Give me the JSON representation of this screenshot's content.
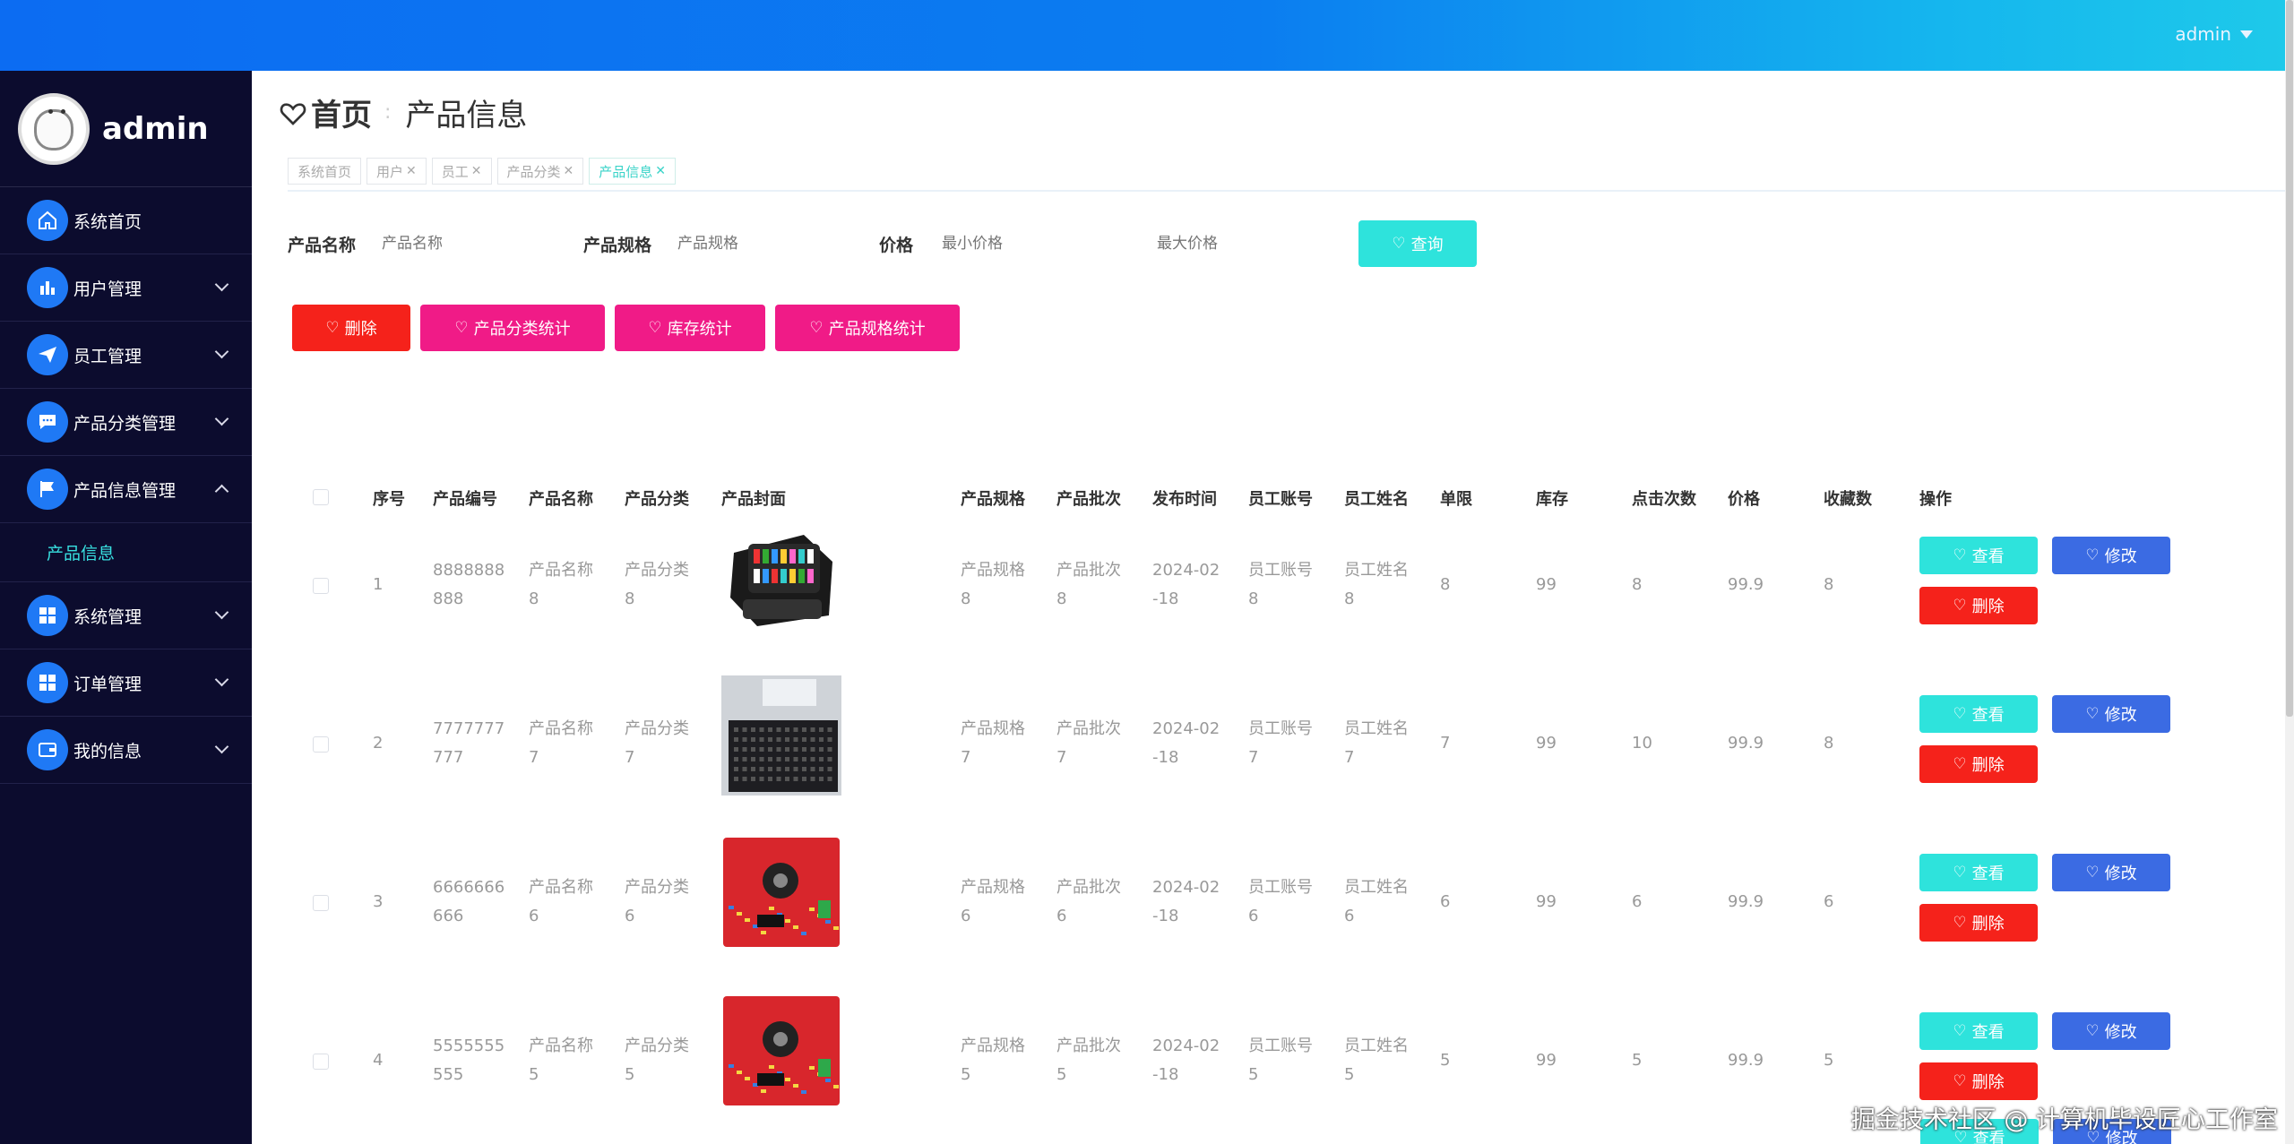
{
  "header": {
    "user": "admin"
  },
  "sidebar": {
    "profile_name": "admin",
    "items": [
      {
        "label": "系统首页",
        "icon": "home-icon"
      },
      {
        "label": "用户管理",
        "icon": "bar-chart-icon"
      },
      {
        "label": "员工管理",
        "icon": "send-icon"
      },
      {
        "label": "产品分类管理",
        "icon": "chat-icon"
      },
      {
        "label": "产品信息管理",
        "icon": "flag-icon"
      },
      {
        "label": "系统管理",
        "icon": "grid-icon"
      },
      {
        "label": "订单管理",
        "icon": "grid-icon"
      },
      {
        "label": "我的信息",
        "icon": "wallet-icon"
      }
    ],
    "submenu": {
      "label": "产品信息"
    }
  },
  "breadcrumb": {
    "home": "首页",
    "sep": ":",
    "current": "产品信息"
  },
  "tabs": [
    {
      "label": "系统首页",
      "closable": false
    },
    {
      "label": "用户",
      "closable": true
    },
    {
      "label": "员工",
      "closable": true
    },
    {
      "label": "产品分类",
      "closable": true
    },
    {
      "label": "产品信息",
      "closable": true
    }
  ],
  "search": {
    "name_label": "产品名称",
    "name_placeholder": "产品名称",
    "spec_label": "产品规格",
    "spec_placeholder": "产品规格",
    "price_label": "价格",
    "min_price_placeholder": "最小价格",
    "max_price_placeholder": "最大价格",
    "query_button": "查询"
  },
  "actions": {
    "delete": "删除",
    "category_stats": "产品分类统计",
    "stock_stats": "库存统计",
    "spec_stats": "产品规格统计"
  },
  "table": {
    "headers": [
      "序号",
      "产品编号",
      "产品名称",
      "产品分类",
      "产品封面",
      "产品规格",
      "产品批次",
      "发布时间",
      "员工账号",
      "员工姓名",
      "单限",
      "库存",
      "点击次数",
      "价格",
      "收藏数",
      "操作"
    ],
    "rows": [
      {
        "idx": "1",
        "code": [
          "8888888",
          "888"
        ],
        "name": [
          "产品名称",
          "8"
        ],
        "cat": [
          "产品分类",
          "8"
        ],
        "cover": "case",
        "spec": [
          "产品规格",
          "8"
        ],
        "batch": [
          "产品批次",
          "8"
        ],
        "date": [
          "2024-02",
          "-18"
        ],
        "acct": [
          "员工账号",
          "8"
        ],
        "staff": [
          "员工姓名",
          "8"
        ],
        "limit": "8",
        "stock": "99",
        "clicks": "8",
        "price": "99.9",
        "favs": "8"
      },
      {
        "idx": "2",
        "code": [
          "7777777",
          "777"
        ],
        "name": [
          "产品名称",
          "7"
        ],
        "cat": [
          "产品分类",
          "7"
        ],
        "cover": "kit",
        "spec": [
          "产品规格",
          "7"
        ],
        "batch": [
          "产品批次",
          "7"
        ],
        "date": [
          "2024-02",
          "-18"
        ],
        "acct": [
          "员工账号",
          "7"
        ],
        "staff": [
          "员工姓名",
          "7"
        ],
        "limit": "7",
        "stock": "99",
        "clicks": "10",
        "price": "99.9",
        "favs": "8"
      },
      {
        "idx": "3",
        "code": [
          "6666666",
          "666"
        ],
        "name": [
          "产品名称",
          "6"
        ],
        "cat": [
          "产品分类",
          "6"
        ],
        "cover": "pcb",
        "spec": [
          "产品规格",
          "6"
        ],
        "batch": [
          "产品批次",
          "6"
        ],
        "date": [
          "2024-02",
          "-18"
        ],
        "acct": [
          "员工账号",
          "6"
        ],
        "staff": [
          "员工姓名",
          "6"
        ],
        "limit": "6",
        "stock": "99",
        "clicks": "6",
        "price": "99.9",
        "favs": "6"
      },
      {
        "idx": "4",
        "code": [
          "5555555",
          "555"
        ],
        "name": [
          "产品名称",
          "5"
        ],
        "cat": [
          "产品分类",
          "5"
        ],
        "cover": "pcb",
        "spec": [
          "产品规格",
          "5"
        ],
        "batch": [
          "产品批次",
          "5"
        ],
        "date": [
          "2024-02",
          "-18"
        ],
        "acct": [
          "员工账号",
          "5"
        ],
        "staff": [
          "员工姓名",
          "5"
        ],
        "limit": "5",
        "stock": "99",
        "clicks": "5",
        "price": "99.9",
        "favs": "5"
      }
    ],
    "row_buttons": {
      "view": "查看",
      "edit": "修改",
      "delete": "删除"
    }
  },
  "watermark": "掘金技术社区 @ 计算机毕设匠心工作室",
  "colors": {
    "accent": "#2ee3dc",
    "danger": "#f5221b",
    "pink": "#f01b87",
    "primary": "#3b6be3",
    "sidebar": "#0c0c2e"
  }
}
